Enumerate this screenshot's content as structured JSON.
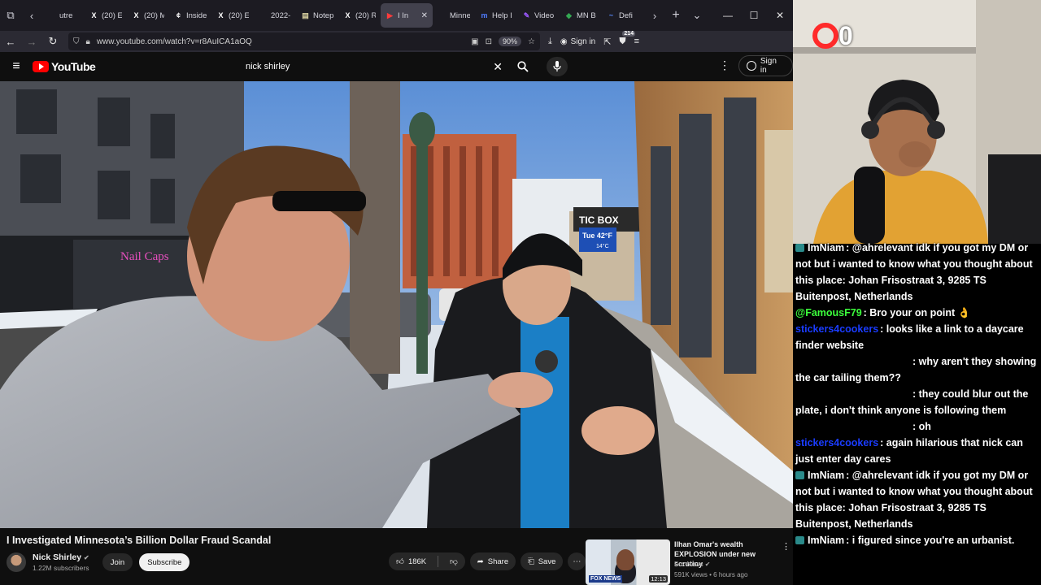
{
  "browser": {
    "tabs": [
      {
        "label": "utre",
        "icon": "",
        "color": "#cfcfd8"
      },
      {
        "label": "(20) E",
        "icon": "X",
        "color": "#ffffff"
      },
      {
        "label": "(20) M",
        "icon": "X",
        "color": "#ffffff"
      },
      {
        "label": "Inside",
        "icon": "¢",
        "color": "#ffffff"
      },
      {
        "label": "(20) E",
        "icon": "X",
        "color": "#ffffff"
      },
      {
        "label": "2022-",
        "icon": "",
        "color": "#cfcfd8"
      },
      {
        "label": "Notep",
        "icon": "▤",
        "color": "#d8d0a0"
      },
      {
        "label": "(20) R",
        "icon": "X",
        "color": "#ffffff"
      },
      {
        "label": "I In",
        "icon": "▶",
        "color": "#ff3b3b",
        "active": true
      },
      {
        "label": "Minne",
        "icon": "",
        "color": "#cfcfd8"
      },
      {
        "label": "Help I",
        "icon": "m",
        "color": "#4f7cff"
      },
      {
        "label": "Video",
        "icon": "✎",
        "color": "#9b59ff"
      },
      {
        "label": "MN B",
        "icon": "◆",
        "color": "#34a853"
      },
      {
        "label": "Defi",
        "icon": "~",
        "color": "#5a8cff"
      }
    ],
    "url": "www.youtube.com/watch?v=r8AuICA1aOQ",
    "zoom": "90%",
    "signin_label": "Sign in",
    "ext_badge": "214"
  },
  "youtube": {
    "logo_text": "YouTube",
    "search_value": "nick shirley",
    "signin_label": "Sign in",
    "video": {
      "title": "I Investigated Minnesota’s Billion Dollar Fraud Scandal",
      "channel": "Nick Shirley",
      "subscribers": "1.22M subscribers",
      "join_label": "Join",
      "subscribe_label": "Subscribe",
      "likes": "186K",
      "share_label": "Share",
      "save_label": "Save",
      "scene_text": {
        "shop_sign": "Nail Caps",
        "marquee": "TIC BOX",
        "temp_top": "Tue 42°F",
        "temp_bottom": "14°C"
      }
    },
    "recommended": {
      "title": "Ilhan Omar's wealth EXPLOSION under new scrutiny",
      "channel": "Fox News",
      "meta": "591K views • 6 hours ago",
      "duration": "12:13",
      "thumb_label": "FOX NEWS"
    }
  },
  "stream": {
    "counter": "0",
    "chat": [
      {
        "user": "ImNiam",
        "user_color": "#ffffff",
        "badge": true,
        "text": ": @ahrelevant idk if you got my DM or not but i wanted to know what you thought about this place: Johan Frisostraat 3, 9285 TS Buitenpost, Netherlands"
      },
      {
        "user": "@FamousF79",
        "user_color": "#3cff3c",
        "badge": false,
        "text": ": Bro your on point 👌"
      },
      {
        "user": "stickers4cookers",
        "user_color": "#1a3cff",
        "badge": false,
        "text": ": looks like a link to a daycare finder website"
      },
      {
        "user": "",
        "user_color": "#ffffff",
        "badge": false,
        "text": ": why aren't they showing the car tailing them??"
      },
      {
        "user": "",
        "user_color": "#ffffff",
        "badge": false,
        "text": ": they could blur out the plate, i don't think anyone is following them"
      },
      {
        "user": "",
        "user_color": "#ffffff",
        "badge": false,
        "text": ": oh"
      },
      {
        "user": "stickers4cookers",
        "user_color": "#1a3cff",
        "badge": false,
        "text": ": again hilarious that nick can just enter day cares"
      },
      {
        "user": "ImNiam",
        "user_color": "#ffffff",
        "badge": true,
        "text": ": @ahrelevant idk if you got my DM or not but i wanted to know what you thought about this place: Johan Frisostraat 3, 9285 TS Buitenpost, Netherlands"
      },
      {
        "user": "ImNiam",
        "user_color": "#ffffff",
        "badge": true,
        "text": ": i figured since you're an urbanist."
      }
    ]
  }
}
